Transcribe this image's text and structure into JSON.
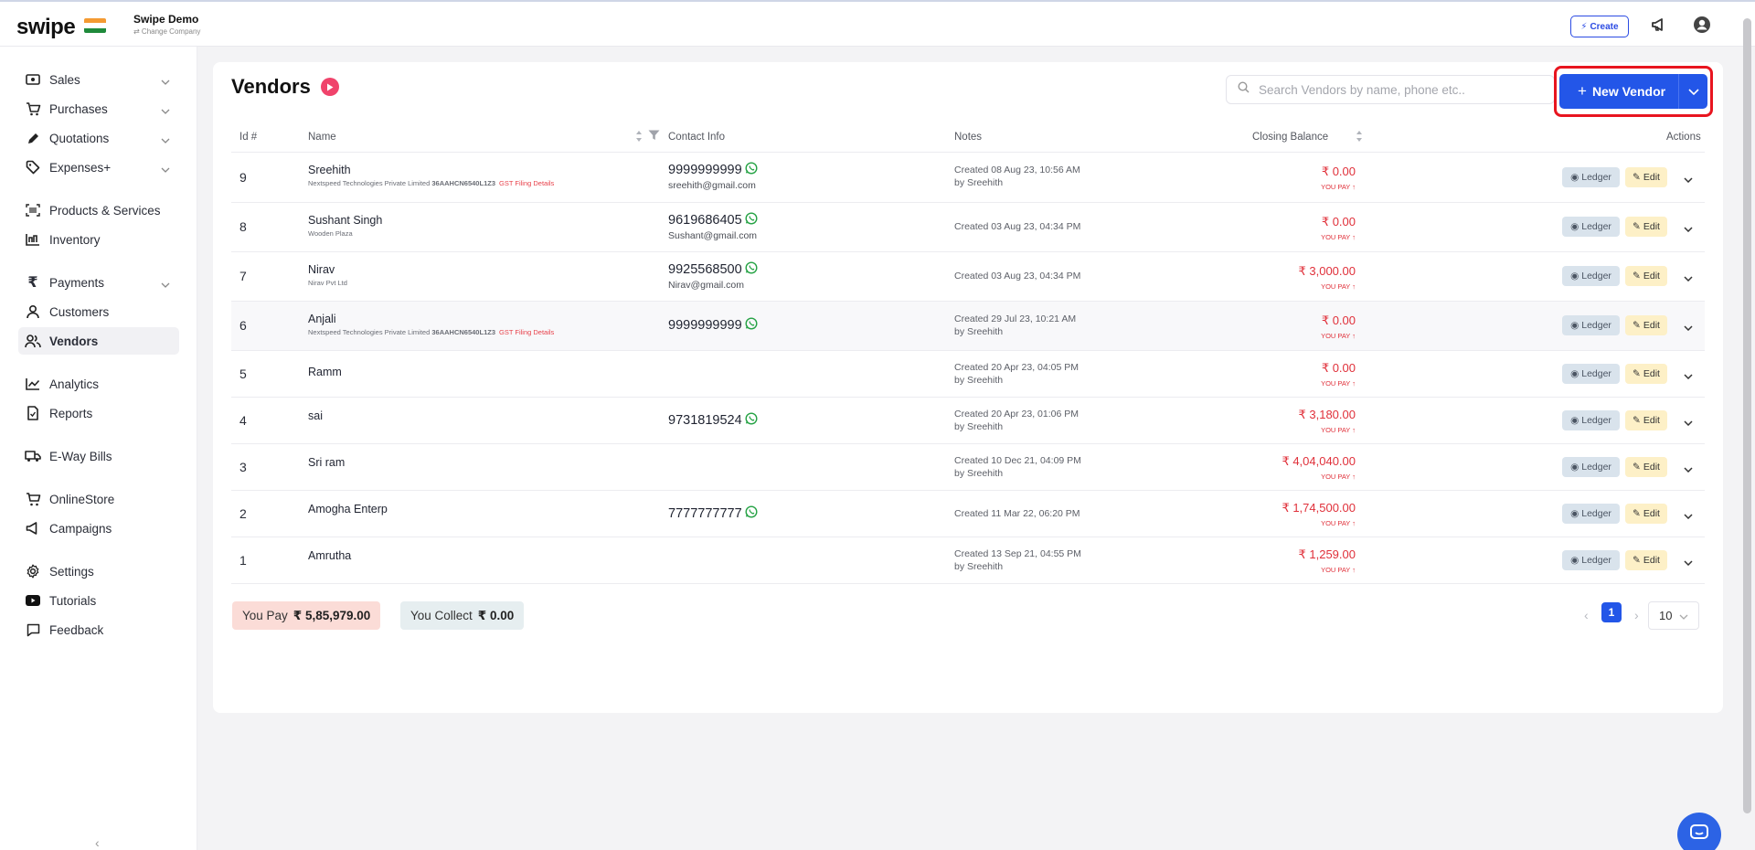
{
  "app": {
    "logo": "swipe",
    "company_name": "Swipe Demo",
    "change_company": "⇄ Change Company",
    "create_label": "Create"
  },
  "sidebar": {
    "items": [
      {
        "label": "Sales",
        "icon": "cash-icon",
        "chevron": true
      },
      {
        "label": "Purchases",
        "icon": "cart-icon",
        "chevron": true
      },
      {
        "label": "Quotations",
        "icon": "pen-icon",
        "chevron": true
      },
      {
        "label": "Expenses+",
        "icon": "tag-icon",
        "chevron": true
      },
      {
        "label": "Products & Services",
        "icon": "barcode-icon",
        "chevron": false
      },
      {
        "label": "Inventory",
        "icon": "inventory-icon",
        "chevron": false
      },
      {
        "label": "Payments",
        "icon": "rupee-icon",
        "chevron": true
      },
      {
        "label": "Customers",
        "icon": "user-icon",
        "chevron": false
      },
      {
        "label": "Vendors",
        "icon": "users-icon",
        "chevron": false,
        "active": true
      },
      {
        "label": "Analytics",
        "icon": "analytics-icon",
        "chevron": false
      },
      {
        "label": "Reports",
        "icon": "report-icon",
        "chevron": false
      },
      {
        "label": "E-Way Bills",
        "icon": "truck-icon",
        "chevron": false
      },
      {
        "label": "OnlineStore",
        "icon": "store-icon",
        "chevron": false
      },
      {
        "label": "Campaigns",
        "icon": "megaphone-icon",
        "chevron": false
      },
      {
        "label": "Settings",
        "icon": "gear-icon",
        "chevron": false
      },
      {
        "label": "Tutorials",
        "icon": "youtube-icon",
        "chevron": false
      },
      {
        "label": "Feedback",
        "icon": "chat-icon",
        "chevron": false
      }
    ]
  },
  "main": {
    "title": "Vendors",
    "search_placeholder": "Search Vendors by name, phone etc..",
    "new_vendor_label": "New Vendor",
    "columns": {
      "id": "Id #",
      "name": "Name",
      "contact": "Contact Info",
      "notes": "Notes",
      "balance": "Closing Balance",
      "actions": "Actions"
    },
    "ledger_label": "Ledger",
    "edit_label": "Edit",
    "rows": [
      {
        "id": "9",
        "name": "Sreehith",
        "company": "Nextspeed Technologies Private Limited",
        "gstin": "36AAHCN6540L1Z3",
        "gst_link": "GST Filing Details",
        "phone": "9999999999",
        "email": "sreehith@gmail.com",
        "note1": "Created 08 Aug 23, 10:56 AM",
        "note2": "by Sreehith",
        "balance": "₹ 0.00",
        "you_pay": "YOU PAY ↑"
      },
      {
        "id": "8",
        "name": "Sushant Singh",
        "company": "Wooden Plaza",
        "gstin": "",
        "gst_link": "",
        "phone": "9619686405",
        "email": "Sushant@gmail.com",
        "note1": "Created 03 Aug 23, 04:34 PM",
        "note2": "",
        "balance": "₹ 0.00",
        "you_pay": "YOU PAY ↑"
      },
      {
        "id": "7",
        "name": "Nirav",
        "company": "Nirav Pvt Ltd",
        "gstin": "",
        "gst_link": "",
        "phone": "9925568500",
        "email": "Nirav@gmail.com",
        "note1": "Created 03 Aug 23, 04:34 PM",
        "note2": "",
        "balance": "₹ 3,000.00",
        "you_pay": "YOU PAY ↑"
      },
      {
        "id": "6",
        "name": "Anjali",
        "company": "Nextspeed Technologies Private Limited",
        "gstin": "36AAHCN6540L1Z3",
        "gst_link": "GST Filing Details",
        "phone": "9999999999",
        "email": "",
        "note1": "Created 29 Jul 23, 10:21 AM",
        "note2": "by Sreehith",
        "balance": "₹ 0.00",
        "you_pay": "YOU PAY ↑"
      },
      {
        "id": "5",
        "name": "Ramm",
        "company": "",
        "gstin": "",
        "gst_link": "",
        "phone": "",
        "email": "",
        "note1": "Created 20 Apr 23, 04:05 PM",
        "note2": "by Sreehith",
        "balance": "₹ 0.00",
        "you_pay": "YOU PAY ↑"
      },
      {
        "id": "4",
        "name": "sai",
        "company": "",
        "gstin": "",
        "gst_link": "",
        "phone": "9731819524",
        "email": "",
        "note1": "Created 20 Apr 23, 01:06 PM",
        "note2": "by Sreehith",
        "balance": "₹ 3,180.00",
        "you_pay": "YOU PAY ↑"
      },
      {
        "id": "3",
        "name": "Sri ram",
        "company": "",
        "gstin": "",
        "gst_link": "",
        "phone": "",
        "email": "",
        "note1": "Created 10 Dec 21, 04:09 PM",
        "note2": "by Sreehith",
        "balance": "₹ 4,04,040.00",
        "you_pay": "YOU PAY ↑"
      },
      {
        "id": "2",
        "name": "Amogha Enterp",
        "company": "",
        "gstin": "",
        "gst_link": "",
        "phone": "7777777777",
        "email": "",
        "note1": "Created 11 Mar 22, 06:20 PM",
        "note2": "",
        "balance": "₹ 1,74,500.00",
        "you_pay": "YOU PAY ↑"
      },
      {
        "id": "1",
        "name": "Amrutha",
        "company": "",
        "gstin": "",
        "gst_link": "",
        "phone": "",
        "email": "",
        "note1": "Created 13 Sep 21, 04:55 PM",
        "note2": "by Sreehith",
        "balance": "₹ 1,259.00",
        "you_pay": "YOU PAY ↑"
      }
    ],
    "summary": {
      "you_pay_label": "You Pay",
      "you_pay_value": "₹ 5,85,979.00",
      "you_collect_label": "You Collect",
      "you_collect_value": "₹ 0.00"
    },
    "pagination": {
      "current_page": "1",
      "page_size": "10"
    }
  },
  "colors": {
    "primary": "#2356e8",
    "danger": "#e0303a",
    "highlight": "#e8151f"
  }
}
